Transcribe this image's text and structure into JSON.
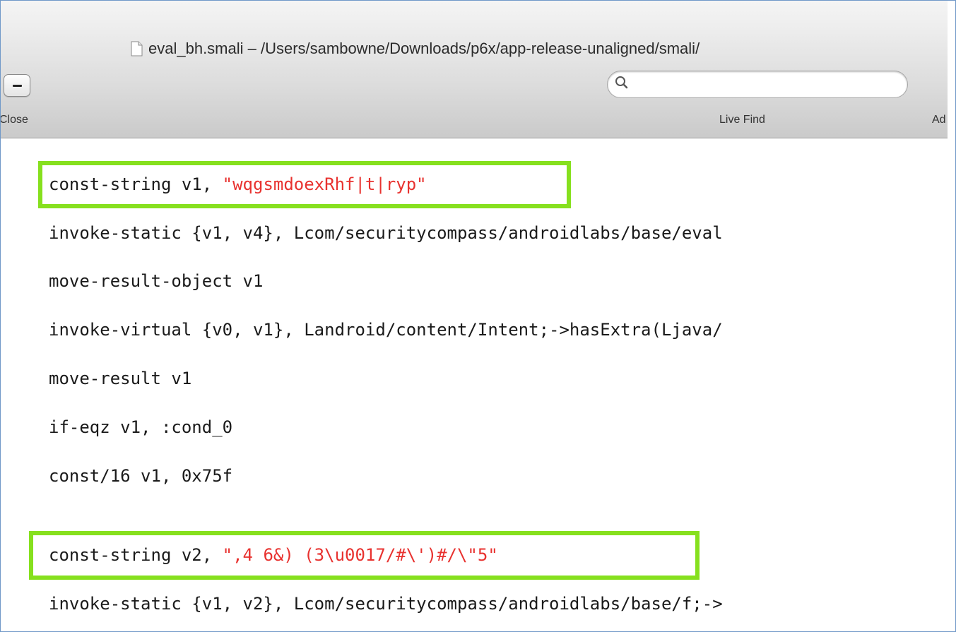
{
  "window": {
    "title": "eval_bh.smali – /Users/sambowne/Downloads/p6x/app-release-unaligned/smali/"
  },
  "toolbar": {
    "close_label": "Close",
    "live_find_label": "Live Find",
    "advanced_label_partial": "Ad",
    "search": {
      "value": "",
      "placeholder": ""
    }
  },
  "icons": {
    "document": "document-icon",
    "search": "magnifier-icon",
    "close": "minus-icon"
  },
  "colors": {
    "highlight_border": "#86e01e",
    "string_literal": "#e8322f",
    "code_text": "#1a1a1a"
  },
  "code": {
    "lines": [
      {
        "plain": "const-string v1, ",
        "str": "\"wqgsmdoexRhf|t|ryp\"",
        "highlighted": true
      },
      {
        "plain": "invoke-static {v1, v4}, Lcom/securitycompass/androidlabs/base/eval",
        "str": "",
        "highlighted": false
      },
      {
        "plain": "move-result-object v1",
        "str": "",
        "highlighted": false
      },
      {
        "plain": "invoke-virtual {v0, v1}, Landroid/content/Intent;->hasExtra(Ljava/",
        "str": "",
        "highlighted": false
      },
      {
        "plain": "move-result v1",
        "str": "",
        "highlighted": false
      },
      {
        "plain": "if-eqz v1, :cond_0",
        "str": "",
        "highlighted": false
      },
      {
        "plain": "const/16 v1, 0x75f",
        "str": "",
        "highlighted": false
      },
      {
        "plain": "const-string v2, ",
        "str": "\",4 6&) (3\\u0017/#\\')#/\\\"5\"",
        "highlighted": true
      },
      {
        "plain": "invoke-static {v1, v2}, Lcom/securitycompass/androidlabs/base/f;->",
        "str": "",
        "highlighted": false
      }
    ]
  }
}
